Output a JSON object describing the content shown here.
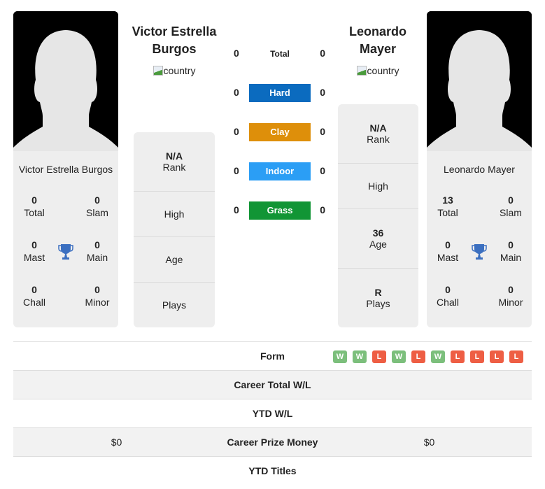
{
  "player_left": {
    "name_header_line1": "Victor Estrella",
    "name_header_line2": "Burgos",
    "card_name": "Victor Estrella Burgos",
    "flag_alt": "country",
    "stats": {
      "total": {
        "value": "0",
        "label": "Total"
      },
      "slam": {
        "value": "0",
        "label": "Slam"
      },
      "mast": {
        "value": "0",
        "label": "Mast"
      },
      "main": {
        "value": "0",
        "label": "Main"
      },
      "chall": {
        "value": "0",
        "label": "Chall"
      },
      "minor": {
        "value": "0",
        "label": "Minor"
      }
    },
    "info": {
      "rank": {
        "value": "N/A",
        "label": "Rank"
      },
      "high": {
        "value": "",
        "label": "High"
      },
      "age": {
        "value": "",
        "label": "Age"
      },
      "plays": {
        "value": "",
        "label": "Plays"
      }
    }
  },
  "player_right": {
    "name_header_line1": "Leonardo",
    "name_header_line2": "Mayer",
    "card_name": "Leonardo Mayer",
    "flag_alt": "country",
    "stats": {
      "total": {
        "value": "13",
        "label": "Total"
      },
      "slam": {
        "value": "0",
        "label": "Slam"
      },
      "mast": {
        "value": "0",
        "label": "Mast"
      },
      "main": {
        "value": "0",
        "label": "Main"
      },
      "chall": {
        "value": "0",
        "label": "Chall"
      },
      "minor": {
        "value": "0",
        "label": "Minor"
      }
    },
    "info": {
      "rank": {
        "value": "N/A",
        "label": "Rank"
      },
      "high": {
        "value": "",
        "label": "High"
      },
      "age": {
        "value": "36",
        "label": "Age"
      },
      "plays": {
        "value": "R",
        "label": "Plays"
      }
    }
  },
  "surfaces": [
    {
      "label": "Total",
      "left": "0",
      "right": "0",
      "color": ""
    },
    {
      "label": "Hard",
      "left": "0",
      "right": "0",
      "color": "#0b6bbf"
    },
    {
      "label": "Clay",
      "left": "0",
      "right": "0",
      "color": "#de8f0a"
    },
    {
      "label": "Indoor",
      "left": "0",
      "right": "0",
      "color": "#2b9ef5"
    },
    {
      "label": "Grass",
      "left": "0",
      "right": "0",
      "color": "#119535"
    }
  ],
  "table": {
    "form": {
      "label": "Form",
      "right_results": [
        "W",
        "W",
        "L",
        "W",
        "L",
        "W",
        "L",
        "L",
        "L",
        "L"
      ]
    },
    "career_wl": {
      "label": "Career Total W/L",
      "left": "",
      "right": ""
    },
    "ytd_wl": {
      "label": "YTD W/L",
      "left": "",
      "right": ""
    },
    "prize": {
      "label": "Career Prize Money",
      "left": "$0",
      "right": "$0"
    },
    "ytd_titles": {
      "label": "YTD Titles",
      "left": "",
      "right": ""
    }
  },
  "icons": {
    "trophy": "trophy-icon",
    "trophy_color": "#3b6fc0",
    "avatar": "silhouette-avatar"
  }
}
